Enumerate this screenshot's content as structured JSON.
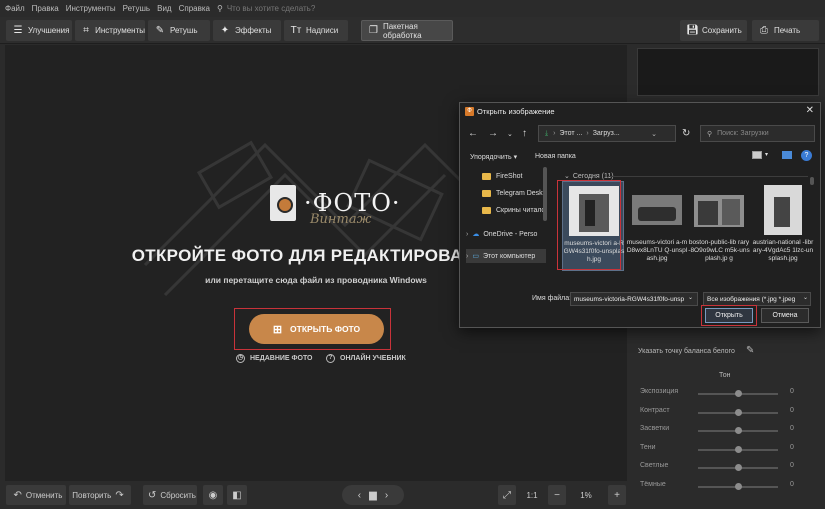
{
  "menu": {
    "items": [
      "Файл",
      "Правка",
      "Инструменты",
      "Ретушь",
      "Вид",
      "Справка"
    ],
    "search_placeholder": "Что вы хотите сделать?"
  },
  "toolbar": {
    "improve": "Улучшения",
    "tools": "Инструменты",
    "retouch": "Ретушь",
    "effects": "Эффекты",
    "captions": "Надписи",
    "batch": "Пакетная обработка",
    "save": "Сохранить",
    "print": "Печать"
  },
  "welcome": {
    "logo_title": "·ФОТО·",
    "logo_sub": "Винтаж",
    "headline": "ОТКРОЙТЕ ФОТО ДЛЯ РЕДАКТИРОВАНИЯ",
    "subline": "или перетащите сюда файл из проводника Windows",
    "open_button": "ОТКРЫТЬ ФОТО",
    "recent": "НЕДАВНИЕ ФОТО",
    "tutorial": "ОНЛАЙН УЧЕБНИК"
  },
  "right_panel": {
    "balance_point": "Указать точку баланса белого",
    "tone_header": "Тон",
    "sliders": [
      {
        "label": "Экспозиция",
        "value": "0",
        "level": 0.5
      },
      {
        "label": "Контраст",
        "value": "0",
        "level": 0.5
      },
      {
        "label": "Засветки",
        "value": "0",
        "level": 0.5
      },
      {
        "label": "Тени",
        "value": "0",
        "level": 0.5
      },
      {
        "label": "Светлые",
        "value": "0",
        "level": 0.5
      },
      {
        "label": "Тёмные",
        "value": "0",
        "level": 0.5
      }
    ]
  },
  "bottom": {
    "undo": "Отменить",
    "redo": "Повторить",
    "reset": "Сбросить",
    "ratio": "1:1",
    "zoom": "1%"
  },
  "dialog": {
    "title": "Открыть изображение",
    "address_parts": [
      "Этот ...",
      "Загруз..."
    ],
    "search_placeholder": "Поиск: Загрузки",
    "organize": "Упорядочить",
    "new_folder": "Новая папка",
    "sidebar": [
      "FireShot",
      "Telegram Deskt",
      "Скрины читалс",
      "OneDrive - Perso",
      "Этот компьютер"
    ],
    "group_header": "Сегодня (11)",
    "files": [
      {
        "name": "museums-victori a-RGW4s31f0fo-unsplash.jpg",
        "selected": true
      },
      {
        "name": "museums-victori a-mD8wx8LnTU Q-unsplash.jpg",
        "selected": false
      },
      {
        "name": "boston-public-lib rary-8O9o9wLC m5k-unsplash.jp g",
        "selected": false
      },
      {
        "name": "austrian-national -library-4VgdAc5 1lzc-unsplash.jpg",
        "selected": false
      }
    ],
    "filename_label": "Имя файла:",
    "filename_value": "museums-victoria-RGW4s31f0fo-unsp",
    "filetype_value": "Все изображения (*.jpg *.jpeg",
    "open_button": "Открыть",
    "cancel_button": "Отмена"
  }
}
